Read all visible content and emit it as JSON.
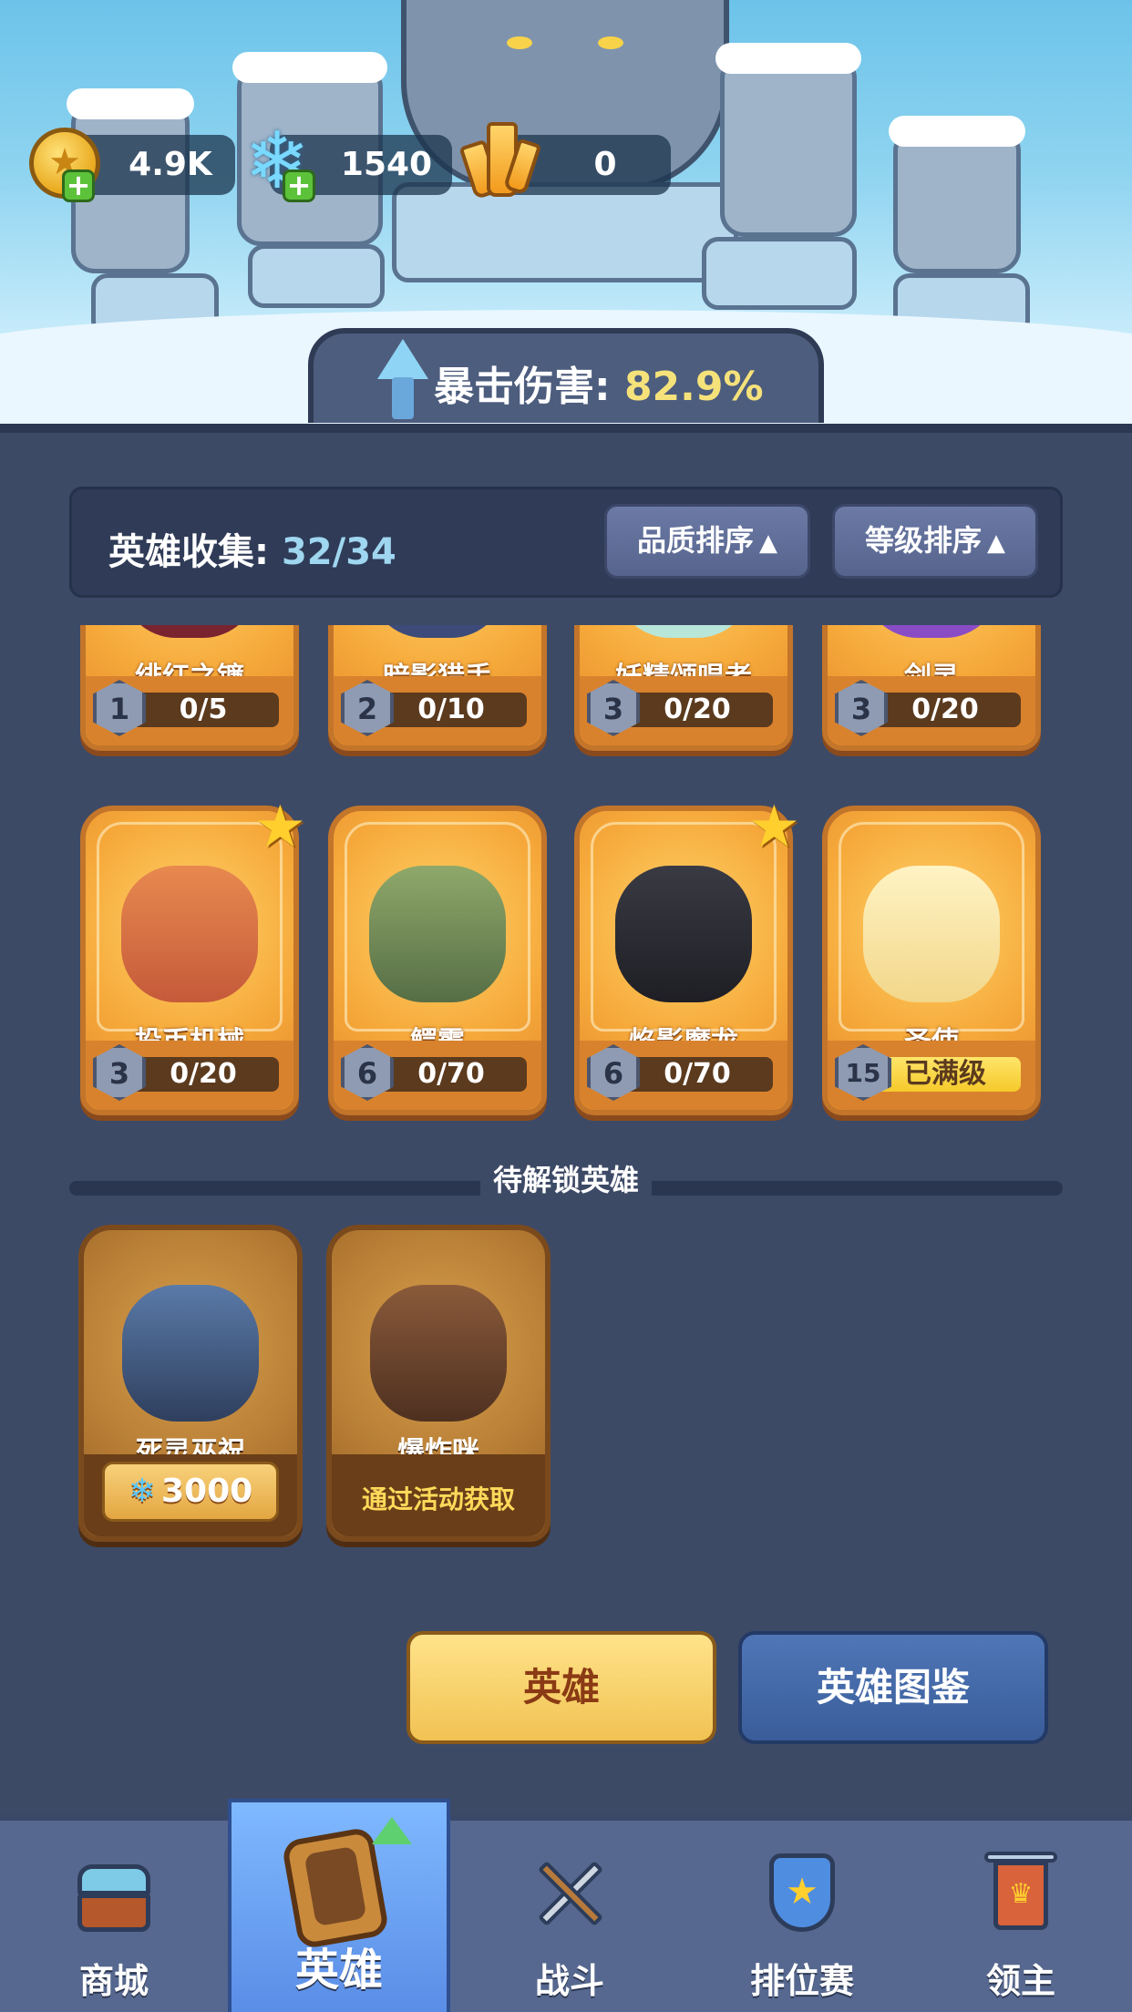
{
  "currency": {
    "gold": "4.9K",
    "gems": "1540",
    "crystals": "0",
    "gold_icon": "gold-coin-icon",
    "gem_icon": "snowflake-gem-icon",
    "crystal_icon": "amber-crystal-icon"
  },
  "crit": {
    "label": "暴击伤害:",
    "value": "82.9%"
  },
  "collection": {
    "label": "英雄收集:",
    "count": "32/34",
    "sort_quality": "品质排序",
    "sort_level": "等级排序",
    "sort_arrow": "▲"
  },
  "heroes_row1": [
    {
      "name": "绯红之镰",
      "level": "1",
      "progress": "0/5"
    },
    {
      "name": "暗影猎手",
      "level": "2",
      "progress": "0/10"
    },
    {
      "name": "妖精颂唱者",
      "level": "3",
      "progress": "0/20"
    },
    {
      "name": "剑灵",
      "level": "3",
      "progress": "0/20"
    }
  ],
  "heroes_row2": [
    {
      "name": "投币机械",
      "level": "3",
      "progress": "0/20",
      "starred": true
    },
    {
      "name": "鳄霸",
      "level": "6",
      "progress": "0/70",
      "starred": false
    },
    {
      "name": "焰影魔龙",
      "level": "6",
      "progress": "0/70",
      "starred": true
    },
    {
      "name": "圣使",
      "level": "15",
      "progress": "已满级",
      "starred": false
    }
  ],
  "locked": {
    "title": "待解锁英雄",
    "heroes": [
      {
        "name": "死灵巫祝",
        "price": "3000"
      },
      {
        "name": "爆炸咪",
        "note": "通过活动获取"
      }
    ]
  },
  "buttons": {
    "hero": "英雄",
    "codex": "英雄图鉴"
  },
  "nav": [
    {
      "label": "商城",
      "icon": "shop-chest-icon"
    },
    {
      "label": "英雄",
      "icon": "hero-card-icon",
      "active": true
    },
    {
      "label": "战斗",
      "icon": "crossed-weapons-icon"
    },
    {
      "label": "排位赛",
      "icon": "rank-shield-icon"
    },
    {
      "label": "领主",
      "icon": "crown-banner-icon"
    }
  ],
  "colors": {
    "accent_gold": "#f6e27a",
    "count_blue": "#9fd6f0",
    "panel_bg": "#3d4a66"
  }
}
